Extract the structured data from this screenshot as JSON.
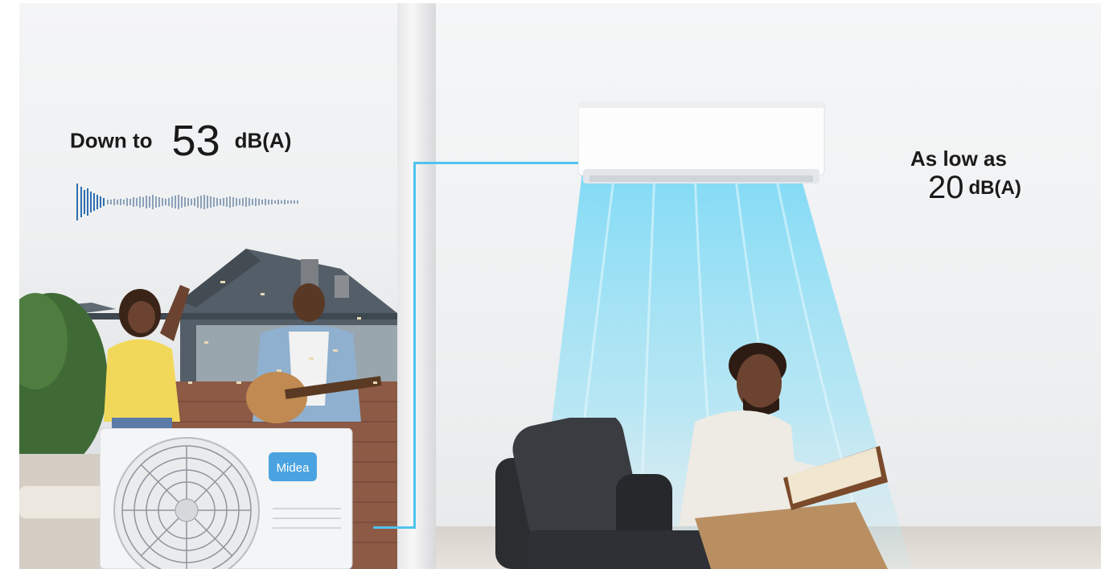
{
  "left_claim": {
    "prefix": "Down to",
    "value": "53",
    "unit": "dB(A)"
  },
  "right_claim": {
    "prefix": "As low as",
    "value": "20",
    "unit": "dB(A)"
  },
  "brand_badge": "Midea",
  "colors": {
    "accent_blue": "#4fc3ee",
    "badge_blue": "#4aa3e0",
    "text": "#1a1a1a"
  }
}
